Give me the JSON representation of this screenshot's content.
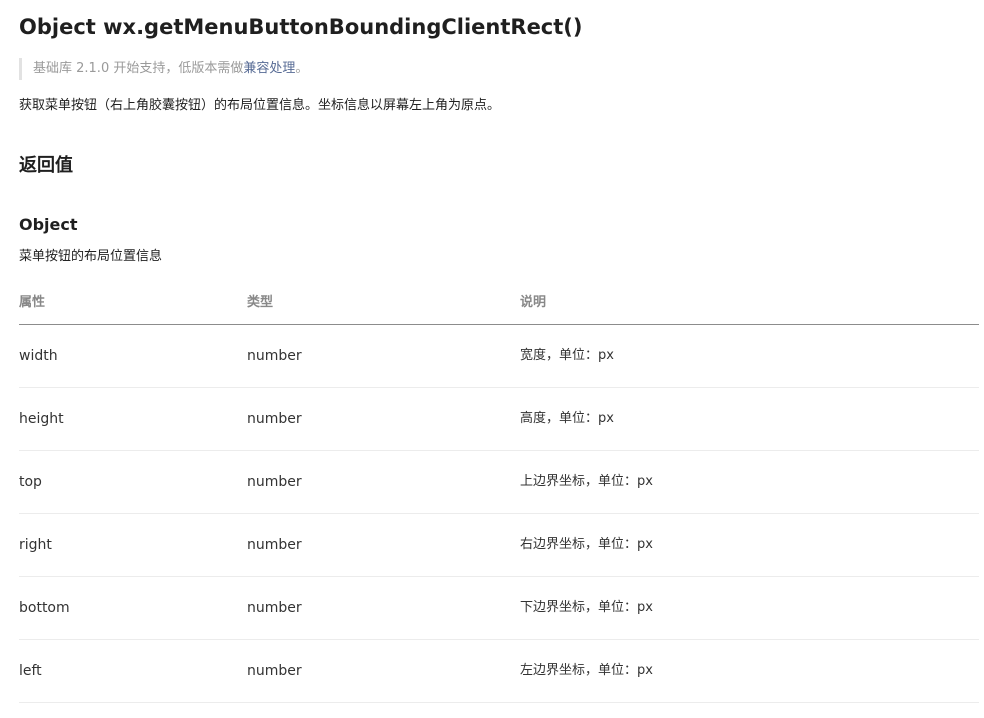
{
  "page": {
    "title": "Object wx.getMenuButtonBoundingClientRect()",
    "note_prefix": "基础库 2.1.0 开始支持，低版本需做",
    "note_link": "兼容处理",
    "note_suffix": "。",
    "description": "获取菜单按钮（右上角胶囊按钮）的布局位置信息。坐标信息以屏幕左上角为原点。"
  },
  "return_section": {
    "title": "返回值",
    "object_title": "Object",
    "object_desc": "菜单按钮的布局位置信息"
  },
  "table": {
    "headers": [
      "属性",
      "类型",
      "说明"
    ],
    "rows": [
      {
        "name": "width",
        "type": "number",
        "desc": "宽度，单位：px"
      },
      {
        "name": "height",
        "type": "number",
        "desc": "高度，单位：px"
      },
      {
        "name": "top",
        "type": "number",
        "desc": "上边界坐标，单位：px"
      },
      {
        "name": "right",
        "type": "number",
        "desc": "右边界坐标，单位：px"
      },
      {
        "name": "bottom",
        "type": "number",
        "desc": "下边界坐标，单位：px"
      },
      {
        "name": "left",
        "type": "number",
        "desc": "左边界坐标，单位：px"
      }
    ]
  },
  "colors": {
    "link": "#576b95",
    "note_text": "#9a9a9a",
    "header_text": "#888888"
  }
}
